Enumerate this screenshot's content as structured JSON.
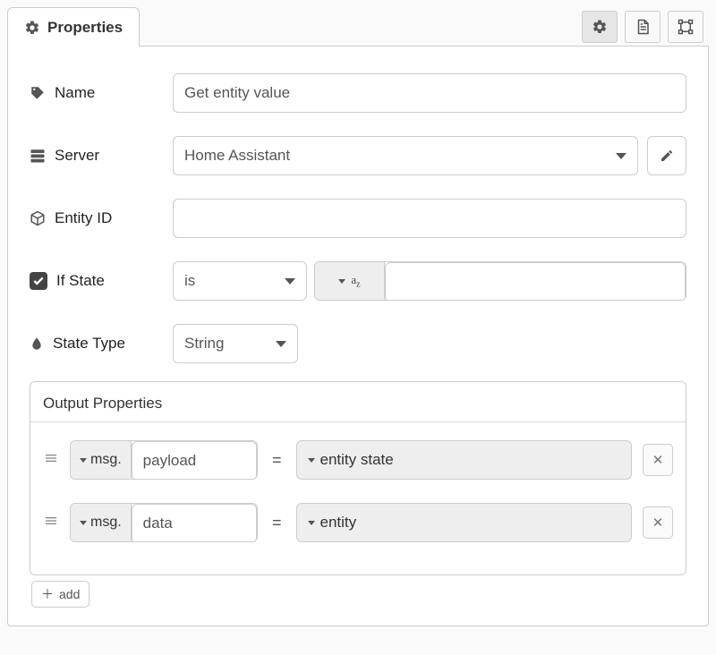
{
  "tab": {
    "title": "Properties"
  },
  "fields": {
    "name": {
      "label": "Name",
      "value": "Get entity value"
    },
    "server": {
      "label": "Server",
      "value": "Home Assistant"
    },
    "entity_id": {
      "label": "Entity ID",
      "value": ""
    },
    "if_state": {
      "label": "If State",
      "op": "is",
      "type_hint": "string",
      "value": ""
    },
    "state_type": {
      "label": "State Type",
      "value": "String"
    }
  },
  "output_properties": {
    "title": "Output Properties",
    "rows": [
      {
        "target_scope": "msg.",
        "target_key": "payload",
        "source": "entity state"
      },
      {
        "target_scope": "msg.",
        "target_key": "data",
        "source": "entity"
      }
    ],
    "add_label": "add",
    "eq": "="
  }
}
